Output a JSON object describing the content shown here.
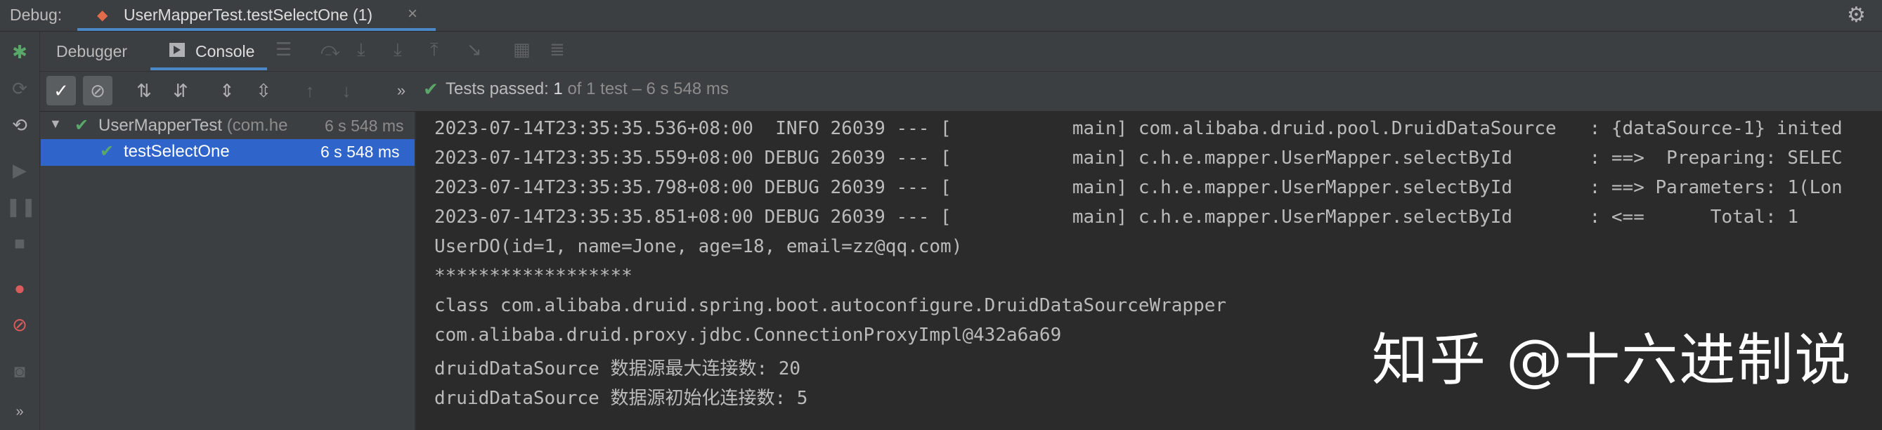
{
  "header": {
    "debug_label": "Debug:",
    "run_tab_label": "UserMapperTest.testSelectOne (1)",
    "run_tab_close": "×",
    "settings_icon": "gear-icon"
  },
  "tabs": {
    "debugger": "Debugger",
    "console": "Console"
  },
  "status": {
    "passed_label": "Tests passed:",
    "passed_count": "1",
    "of_total": "of 1 test – 6 s 548 ms"
  },
  "tree": {
    "root_name": "UserMapperTest",
    "root_package": "(com.he",
    "root_time": "6 s 548 ms",
    "child_name": "testSelectOne",
    "child_time": "6 s 548 ms"
  },
  "console_lines": [
    "2023-07-14T23:35:35.536+08:00  INFO 26039 --- [           main] com.alibaba.druid.pool.DruidDataSource   : {dataSource-1} inited",
    "2023-07-14T23:35:35.559+08:00 DEBUG 26039 --- [           main] c.h.e.mapper.UserMapper.selectById       : ==>  Preparing: SELEC",
    "2023-07-14T23:35:35.798+08:00 DEBUG 26039 --- [           main] c.h.e.mapper.UserMapper.selectById       : ==> Parameters: 1(Lon",
    "2023-07-14T23:35:35.851+08:00 DEBUG 26039 --- [           main] c.h.e.mapper.UserMapper.selectById       : <==      Total: 1",
    "UserDO(id=1, name=Jone, age=18, email=zz@qq.com)",
    "******************",
    "class com.alibaba.druid.spring.boot.autoconfigure.DruidDataSourceWrapper",
    "com.alibaba.druid.proxy.jdbc.ConnectionProxyImpl@432a6a69",
    "druidDataSource 数据源最大连接数: 20",
    "druidDataSource 数据源初始化连接数: 5"
  ],
  "watermark": "知乎 @十六进制说",
  "colors": {
    "accent": "#4a88c7",
    "pass_green": "#59a869",
    "selection": "#2f65ca",
    "debug_green": "#59a869",
    "breakpoint_red": "#db5c5c"
  }
}
